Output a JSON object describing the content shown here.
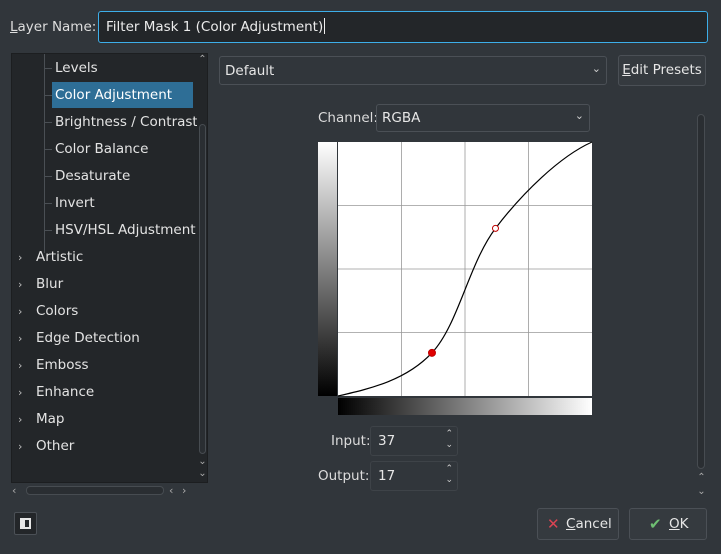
{
  "header": {
    "layer_name_label_first": "L",
    "layer_name_label_rest": "ayer Name:",
    "layer_name_value": "Filter Mask 1 (Color Adjustment)"
  },
  "tree": {
    "children": [
      "Levels",
      "Color Adjustment",
      "Brightness / Contrast",
      "Color Balance",
      "Desaturate",
      "Invert",
      "HSV/HSL Adjustment"
    ],
    "selected": "Color Adjustment",
    "categories": [
      "Artistic",
      "Blur",
      "Colors",
      "Edge Detection",
      "Emboss",
      "Enhance",
      "Map",
      "Other"
    ]
  },
  "presets": {
    "value": "Default",
    "edit_first": "E",
    "edit_rest": "dit Presets"
  },
  "channel": {
    "label": "Channel:",
    "value": "RGBA"
  },
  "curve": {
    "input_label": "Input:",
    "input_value": "37",
    "output_label": "Output:",
    "output_value": "17",
    "points": [
      [
        0,
        0
      ],
      [
        37,
        17
      ],
      [
        62,
        66
      ],
      [
        100,
        100
      ]
    ],
    "selected_point": [
      37,
      17
    ],
    "grid_divisions": 4
  },
  "buttons": {
    "cancel_first": "C",
    "cancel_rest": "ancel",
    "ok_first": "O",
    "ok_rest": "K"
  },
  "colors": {
    "background": "#31363b",
    "accent": "#3daee9",
    "selection": "#2e6e96",
    "point_selected": "#e00000",
    "point": "#c00000"
  },
  "icons": {
    "tree_expand": "chevron-right-icon",
    "combo": "chevron-down-icon",
    "cancel": "x-icon",
    "ok": "check-icon",
    "panel_toggle": "sidebar-icon"
  }
}
